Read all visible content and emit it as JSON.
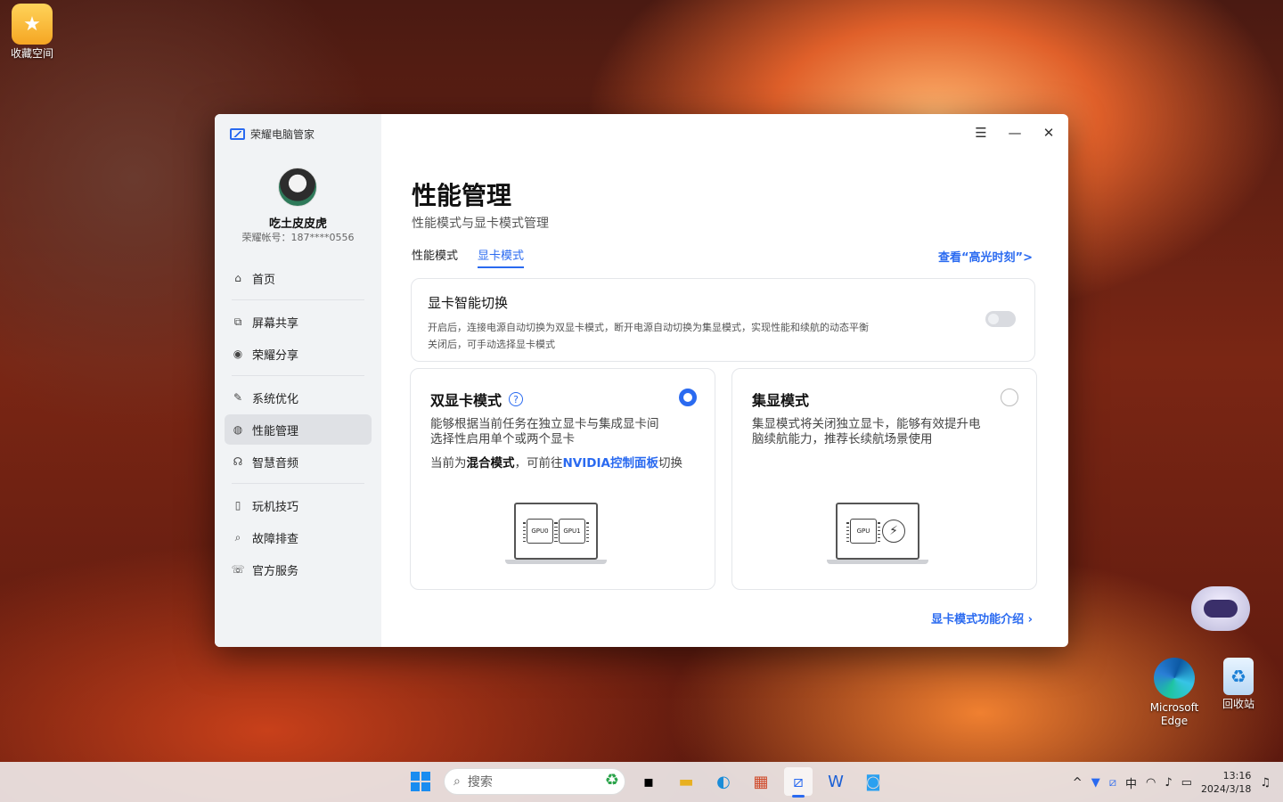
{
  "desktop": {
    "icons": [
      {
        "label": "收藏空间"
      },
      {
        "label": ""
      },
      {
        "label": "Microsoft Edge"
      },
      {
        "label": "回收站"
      }
    ]
  },
  "app": {
    "title": "荣耀电脑管家",
    "user": {
      "name": "吃土皮皮虎",
      "account": "荣耀帐号：187****0556"
    },
    "nav": [
      {
        "label": "首页",
        "icon": "home-icon"
      },
      {
        "label": "屏幕共享",
        "icon": "screen-share-icon"
      },
      {
        "label": "荣耀分享",
        "icon": "share-icon"
      },
      {
        "label": "系统优化",
        "icon": "optimize-icon"
      },
      {
        "label": "性能管理",
        "icon": "performance-icon"
      },
      {
        "label": "智慧音频",
        "icon": "headphones-icon"
      },
      {
        "label": "玩机技巧",
        "icon": "tips-icon"
      },
      {
        "label": "故障排查",
        "icon": "diagnose-icon"
      },
      {
        "label": "官方服务",
        "icon": "service-icon"
      }
    ],
    "active_nav": "性能管理"
  },
  "page": {
    "title": "性能管理",
    "subtitle": "性能模式与显卡模式管理",
    "tabs": [
      {
        "label": "性能模式"
      },
      {
        "label": "显卡模式"
      }
    ],
    "active_tab": "显卡模式",
    "highlight_link": "查看“高光时刻”>",
    "smart_switch": {
      "title": "显卡智能切换",
      "desc1": "开启后，连接电源自动切换为双显卡模式，断开电源自动切换为集显模式，实现性能和续航的动态平衡",
      "desc2": "关闭后，可手动选择显卡模式",
      "enabled": false
    },
    "modes": [
      {
        "title": "双显卡模式",
        "desc": "能够根据当前任务在独立显卡与集成显卡间选择性启用单个或两个显卡",
        "current_prefix": "当前为",
        "current_mode": "混合模式",
        "current_mid": "，可前往",
        "current_link": "NVIDIA控制面板",
        "current_suffix": "切换",
        "chips": [
          "GPU0",
          "GPU1"
        ],
        "selected": true
      },
      {
        "title": "集显模式",
        "desc": "集显模式将关闭独立显卡，能够有效提升电脑续航能力，推荐长续航场景使用",
        "chips": [
          "GPU"
        ],
        "selected": false
      }
    ],
    "intro_link": "显卡模式功能介绍"
  },
  "taskbar": {
    "search_placeholder": "搜索",
    "ime": "中",
    "time": "13:16",
    "date": "2024/3/18"
  },
  "colors": {
    "accent": "#2a6af0",
    "sidebar": "#f1f3f5"
  }
}
